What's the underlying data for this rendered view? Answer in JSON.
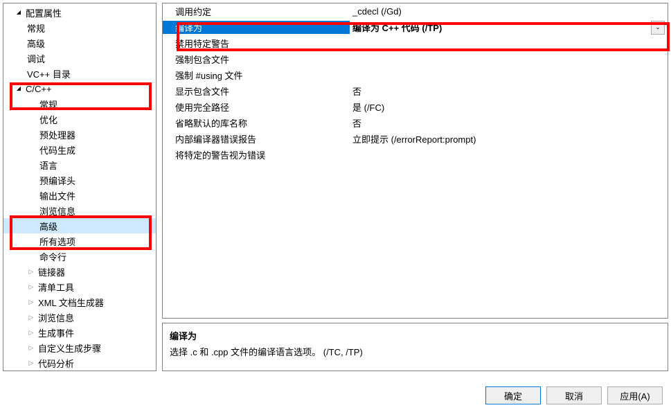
{
  "sidebar": {
    "root": "配置属性",
    "items_l2a": [
      "常规",
      "高级",
      "调试",
      "VC++ 目录"
    ],
    "cpp": "C/C++",
    "cpp_items": [
      "常规",
      "优化",
      "预处理器",
      "代码生成",
      "语言",
      "预编译头",
      "输出文件",
      "浏览信息",
      "高级",
      "所有选项",
      "命令行"
    ],
    "items_l2b": [
      "链接器",
      "清单工具",
      "XML 文档生成器",
      "浏览信息",
      "生成事件",
      "自定义生成步骤",
      "代码分析"
    ]
  },
  "props": {
    "rows": [
      {
        "label": "调用约定",
        "value": "_cdecl (/Gd)"
      },
      {
        "label": "编译为",
        "value": "编译为 C++ 代码 (/TP)"
      },
      {
        "label": "禁用特定警告",
        "value": ""
      },
      {
        "label": "强制包含文件",
        "value": ""
      },
      {
        "label": "强制 #using 文件",
        "value": ""
      },
      {
        "label": "显示包含文件",
        "value": "否"
      },
      {
        "label": "使用完全路径",
        "value": "是 (/FC)"
      },
      {
        "label": "省略默认的库名称",
        "value": "否"
      },
      {
        "label": "内部编译器错误报告",
        "value": "立即提示 (/errorReport:prompt)"
      },
      {
        "label": "将特定的警告视为错误",
        "value": ""
      }
    ]
  },
  "desc": {
    "title": "编译为",
    "text": "选择 .c 和 .cpp 文件的编译语言选项。     (/TC, /TP)"
  },
  "buttons": {
    "ok": "确定",
    "cancel": "取消",
    "apply": "应用(A)"
  }
}
